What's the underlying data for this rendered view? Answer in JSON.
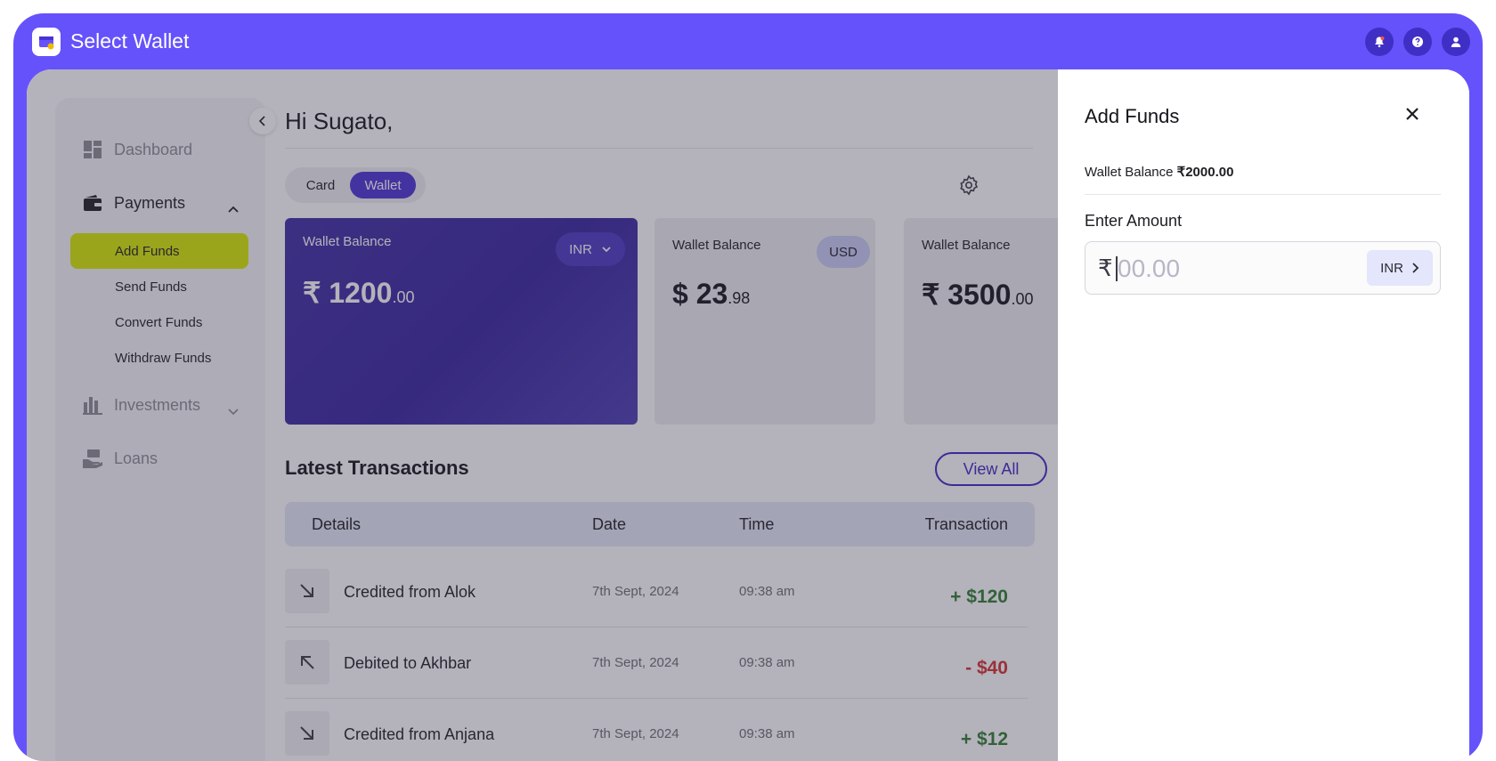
{
  "app": {
    "title": "Select Wallet"
  },
  "sidebar": {
    "dashboard": "Dashboard",
    "payments": "Payments",
    "payments_sub": [
      "Add Funds",
      "Send Funds",
      "Convert Funds",
      "Withdraw Funds"
    ],
    "investments": "Investments",
    "loans": "Loans"
  },
  "main": {
    "greeting": "Hi Sugato,",
    "toggle": {
      "card": "Card",
      "wallet": "Wallet",
      "selected": "Wallet"
    },
    "wallets": [
      {
        "label": "Wallet Balance",
        "symbol": "₹",
        "integer": "1200",
        "decimal": ".00",
        "currency": "INR"
      },
      {
        "label": "Wallet Balance",
        "symbol": "$",
        "integer": "23",
        "decimal": ".98",
        "currency": "USD"
      },
      {
        "label": "Wallet Balance",
        "symbol": "₹",
        "integer": "3500",
        "decimal": ".00"
      }
    ],
    "transactions_title": "Latest Transactions",
    "view_all": "View All",
    "columns": [
      "Details",
      "Date",
      "Time",
      "Transaction"
    ],
    "transactions": [
      {
        "name": "Credited from Alok",
        "date": "7th Sept, 2024",
        "time": "09:38 am",
        "amount": "+ $120",
        "direction": "in"
      },
      {
        "name": "Debited to Akhbar",
        "date": "7th Sept, 2024",
        "time": "09:38 am",
        "amount": "- $40",
        "direction": "out"
      },
      {
        "name": "Credited from Anjana",
        "date": "7th Sept, 2024",
        "time": "09:38 am",
        "amount": "+ $12",
        "direction": "in"
      }
    ]
  },
  "drawer": {
    "title": "Add Funds",
    "balance_label": "Wallet Balance",
    "balance_value": "₹2000.00",
    "enter_amount_label": "Enter Amount",
    "amount_symbol": "₹",
    "amount_placeholder": "00.00",
    "amount_value": "",
    "currency": "INR"
  },
  "colors": {
    "brand": "#6552fb",
    "accent": "#4a32d6",
    "highlight": "#d6ea00",
    "credit": "#2e7d32",
    "debit": "#d32f2f"
  },
  "icons": {
    "logo": "wallet-logo-icon",
    "notifications": "bell-icon",
    "help": "help-icon",
    "profile": "user-icon"
  }
}
